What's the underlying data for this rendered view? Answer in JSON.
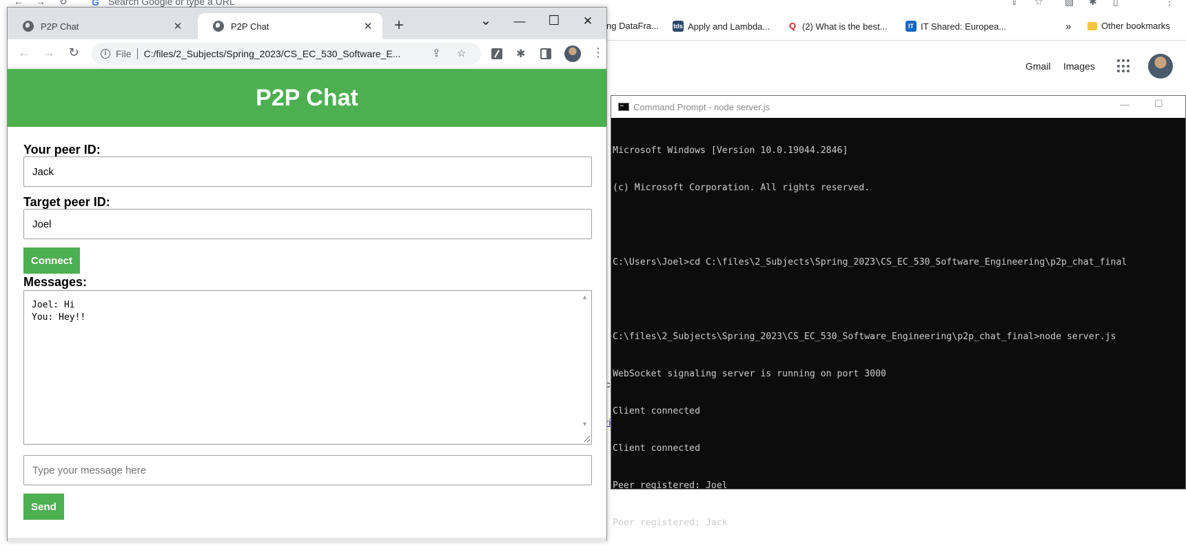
{
  "background_browser": {
    "omnibox_placeholder": "Search Google or type a URL",
    "bookmarks": [
      {
        "label": "ng DataFra...",
        "icon": "bookmark-fragment"
      },
      {
        "label": "Apply and Lambda...",
        "icon": "tds-icon",
        "badge": "tds"
      },
      {
        "label": "(2) What is the best...",
        "icon": "quora-icon",
        "badge": "Q"
      },
      {
        "label": "IT Shared: Europea...",
        "icon": "it-icon",
        "badge": "IT"
      }
    ],
    "bookmarks_overflow": "»",
    "other_bookmarks": "Other bookmarks",
    "google_links": {
      "gmail": "Gmail",
      "images": "Images"
    },
    "fragments": {
      "frag_c": "c",
      "frag_ri": "ri"
    }
  },
  "cmd": {
    "title": "Command Prompt - node  server.js",
    "lines": [
      "Microsoft Windows [Version 10.0.19044.2846]",
      "(c) Microsoft Corporation. All rights reserved.",
      "",
      "C:\\Users\\Joel>cd C:\\files\\2_Subjects\\Spring_2023\\CS_EC_530_Software_Engineering\\p2p_chat_final",
      "",
      "C:\\files\\2_Subjects\\Spring_2023\\CS_EC_530_Software_Engineering\\p2p_chat_final>node server.js",
      "WebSocket signaling server is running on port 3000",
      "Client connected",
      "Client connected",
      "Peer registered: Joel",
      "Peer registered: Jack"
    ],
    "minimize": "—",
    "maximize": "☐"
  },
  "chrome": {
    "tabs": [
      {
        "title": "P2P Chat",
        "active": false
      },
      {
        "title": "P2P Chat",
        "active": true
      }
    ],
    "new_tab": "+",
    "tab_search": "⌄",
    "minimize": "—",
    "maximize": "☐",
    "close": "✕",
    "omnibox": {
      "scheme": "File",
      "url": "C:/files/2_Subjects/Spring_2023/CS_EC_530_Software_E..."
    }
  },
  "page": {
    "header": "P2P Chat",
    "your_peer_label": "Your peer ID:",
    "your_peer_value": "Jack",
    "target_peer_label": "Target peer ID:",
    "target_peer_value": "Joel",
    "connect_button": "Connect",
    "messages_label": "Messages:",
    "messages": "Joel: Hi\nYou: Hey!!",
    "message_input_placeholder": "Type your message here",
    "send_button": "Send"
  },
  "colors": {
    "accent_green": "#4caf50",
    "terminal_bg": "#0c0c0c",
    "terminal_fg": "#cccccc"
  }
}
